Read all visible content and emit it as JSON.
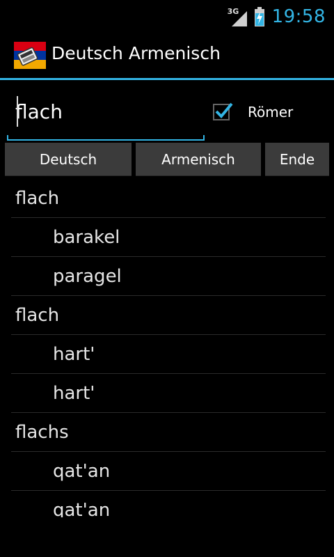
{
  "status_bar": {
    "network": "3G",
    "time": "19:58",
    "icons": [
      "signal-icon",
      "battery-charging-icon"
    ]
  },
  "action_bar": {
    "title": "Deutsch Armenisch",
    "icon": "armenian-flag-dictionary-icon"
  },
  "search": {
    "value": "flach",
    "checkbox_label": "Römer",
    "checkbox_checked": true
  },
  "buttons": {
    "deutsch": "Deutsch",
    "armenisch": "Armenisch",
    "ende": "Ende"
  },
  "results": [
    {
      "type": "head",
      "text": "flach"
    },
    {
      "type": "sub",
      "text": "barakel"
    },
    {
      "type": "sub",
      "text": "paragel"
    },
    {
      "type": "head",
      "text": "flach"
    },
    {
      "type": "sub",
      "text": "hart'"
    },
    {
      "type": "sub",
      "text": "hart'"
    },
    {
      "type": "head",
      "text": "flachs"
    },
    {
      "type": "sub",
      "text": "qat'an"
    },
    {
      "type": "sub",
      "text": "qat'an"
    }
  ],
  "colors": {
    "accent": "#33b5e5",
    "background": "#000000",
    "button": "#3b3b3b"
  }
}
